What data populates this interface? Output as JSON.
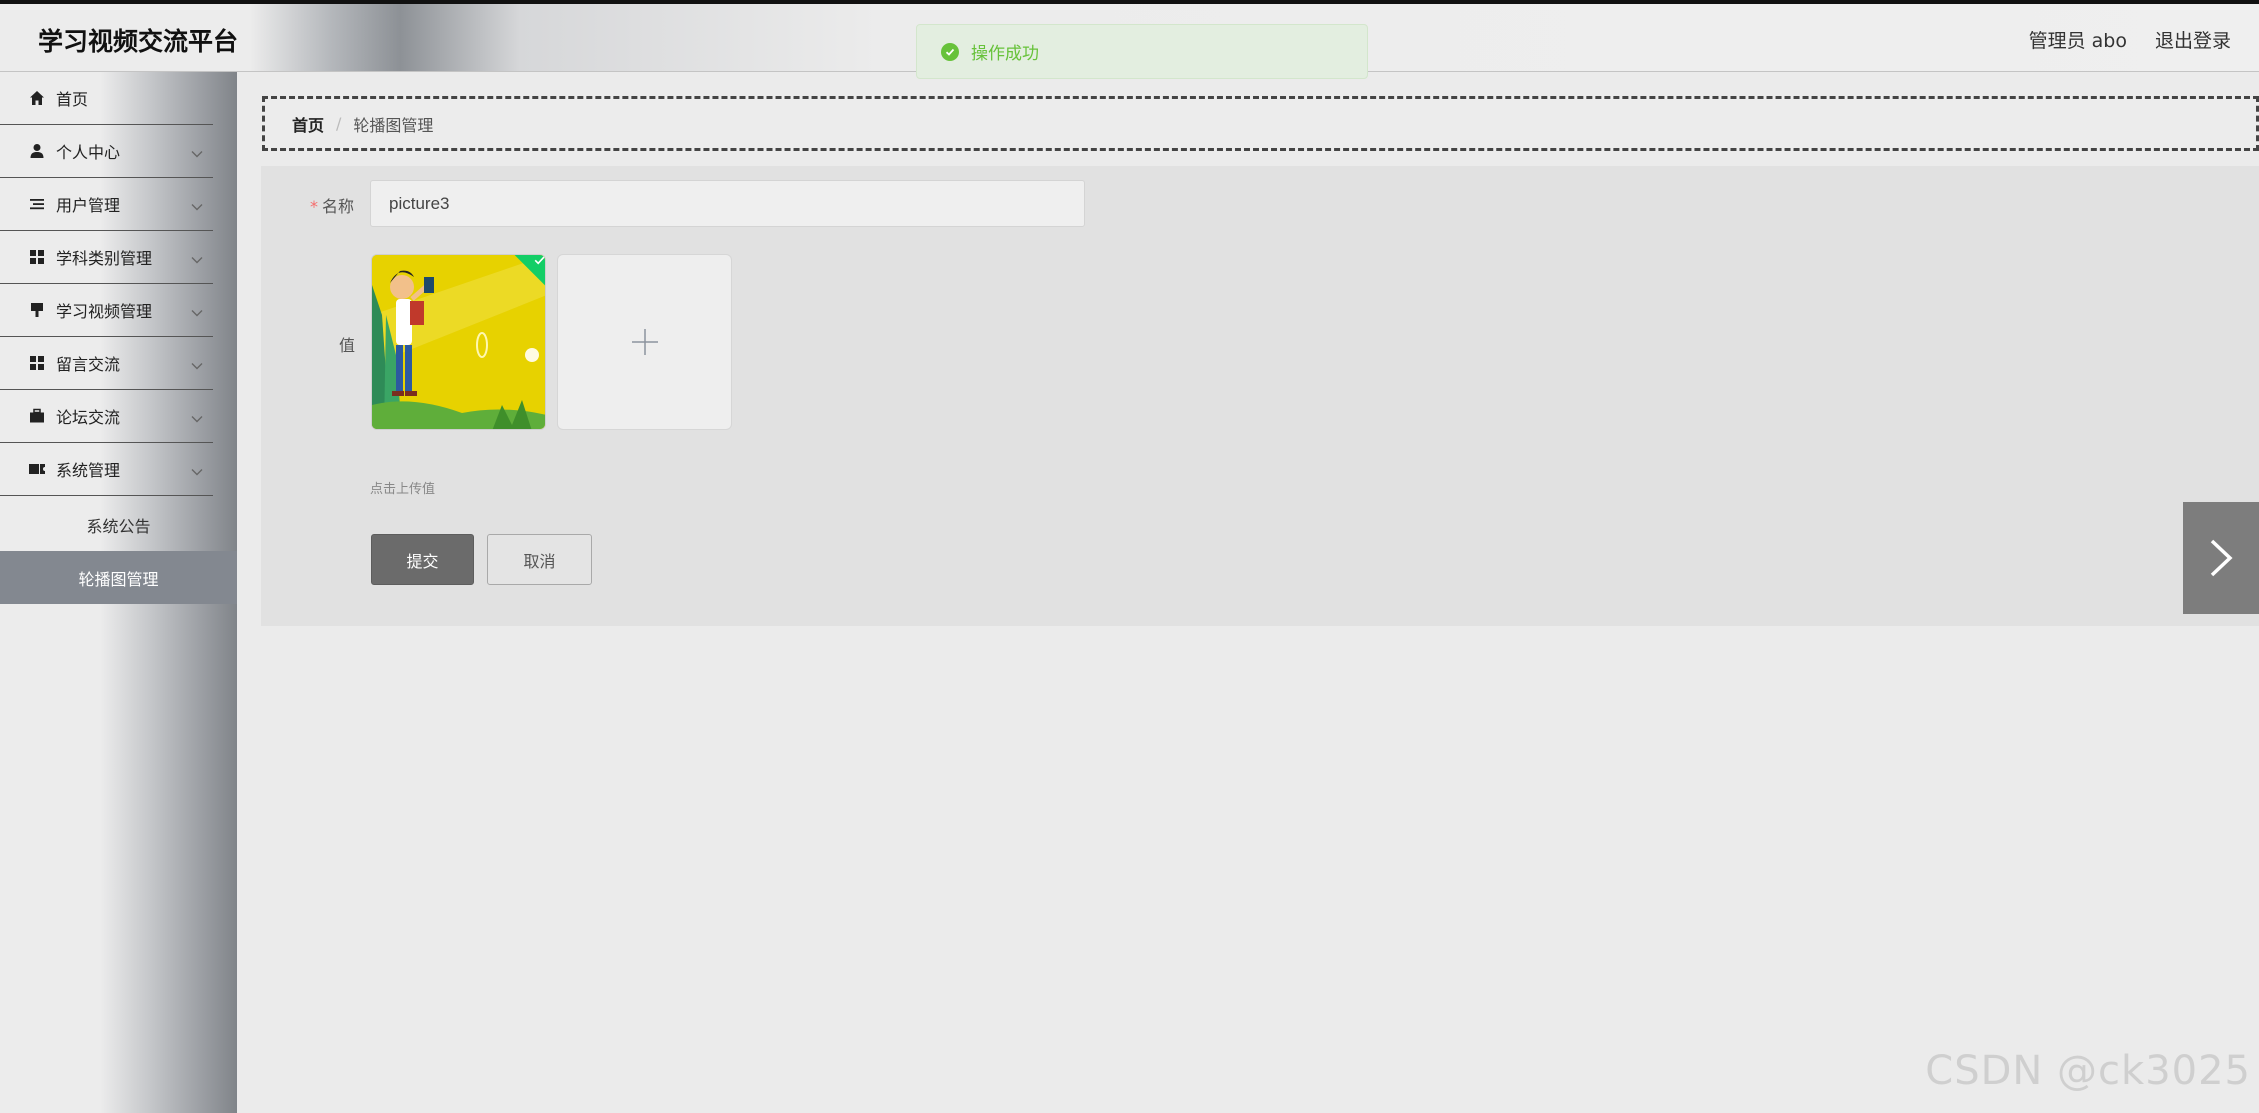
{
  "header": {
    "app_title": "学习视频交流平台",
    "user_label": "管理员 abo",
    "logout_label": "退出登录"
  },
  "toast": {
    "message": "操作成功",
    "color": "#67c23a"
  },
  "sidebar": {
    "items": [
      {
        "label": "首页",
        "icon": "home-icon"
      },
      {
        "label": "个人中心",
        "icon": "user-icon"
      },
      {
        "label": "用户管理",
        "icon": "list-icon"
      },
      {
        "label": "学科类别管理",
        "icon": "grid-icon"
      },
      {
        "label": "学习视频管理",
        "icon": "video-icon"
      },
      {
        "label": "留言交流",
        "icon": "grid-icon"
      },
      {
        "label": "论坛交流",
        "icon": "briefcase-icon"
      },
      {
        "label": "系统管理",
        "icon": "ticket-icon"
      }
    ],
    "sub_items": [
      {
        "label": "系统公告"
      },
      {
        "label": "轮播图管理",
        "active": true
      }
    ]
  },
  "breadcrumb": {
    "home": "首页",
    "separator": "/",
    "current": "轮播图管理"
  },
  "form": {
    "name_label": "名称",
    "name_value": "picture3",
    "value_label": "值",
    "upload_tip": "点击上传值",
    "submit_label": "提交",
    "cancel_label": "取消"
  },
  "watermark": "CSDN @ck3025",
  "colors": {
    "accent_gray": "#6b6b6b",
    "success_green": "#13ce66"
  }
}
